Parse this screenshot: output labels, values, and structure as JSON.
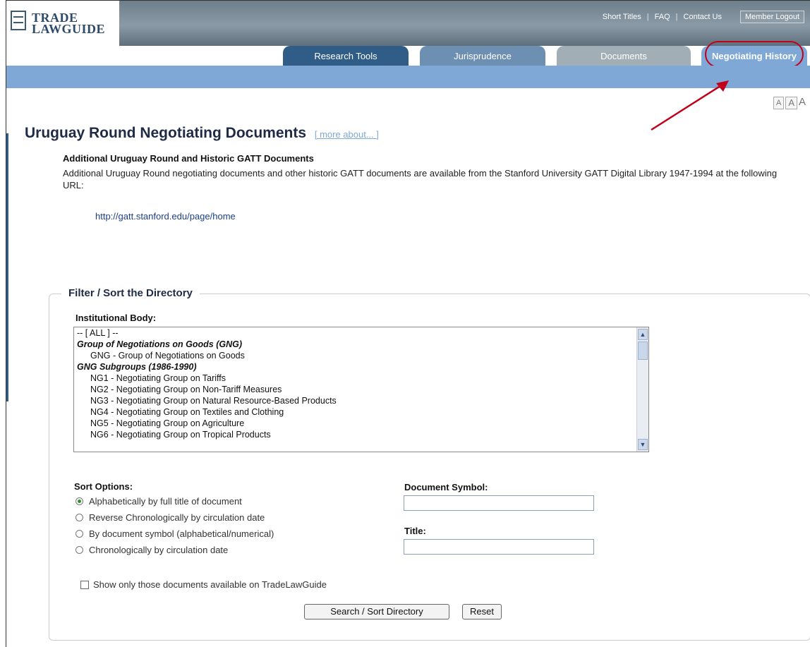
{
  "header": {
    "logo_line1": "TRADE",
    "logo_line2": "LAWGUIDE",
    "links": [
      "Short Titles",
      "FAQ",
      "Contact Us"
    ],
    "logout_label": "Member Logout"
  },
  "tabs": [
    {
      "label": "Research Tools"
    },
    {
      "label": "Jurisprudence"
    },
    {
      "label": "Documents"
    },
    {
      "label": "Negotiating History"
    }
  ],
  "text_size": [
    "A",
    "A",
    "A"
  ],
  "page": {
    "title": "Uruguay Round Negotiating Documents",
    "more_link": "[ more about... ]",
    "additional_heading": "Additional Uruguay Round and Historic GATT Documents",
    "additional_body": "Additional Uruguay Round negotiating documents and other historic GATT documents are available from the Stanford University GATT Digital Library 1947-1994 at the following URL:",
    "url": "http://gatt.stanford.edu/page/home"
  },
  "filter": {
    "legend": "Filter / Sort the Directory",
    "institutional_label": "Institutional Body:",
    "list_items": [
      {
        "text": "-- [ ALL ] --",
        "type": "all"
      },
      {
        "text": "Group of Negotiations on Goods (GNG)",
        "type": "group"
      },
      {
        "text": "GNG - Group of Negotiations on Goods",
        "type": "indent"
      },
      {
        "text": "GNG Subgroups (1986-1990)",
        "type": "group"
      },
      {
        "text": "NG1 - Negotiating Group on Tariffs",
        "type": "indent"
      },
      {
        "text": "NG2 - Negotiating Group on Non-Tariff Measures",
        "type": "indent"
      },
      {
        "text": "NG3 - Negotiating Group on Natural Resource-Based Products",
        "type": "indent"
      },
      {
        "text": "NG4 - Negotiating Group on Textiles and Clothing",
        "type": "indent"
      },
      {
        "text": "NG5 - Negotiating Group on Agriculture",
        "type": "indent"
      },
      {
        "text": "NG6 - Negotiating Group on Tropical Products",
        "type": "indent"
      }
    ],
    "sort_label": "Sort Options:",
    "sort_options": [
      {
        "label": "Alphabetically by full title of document",
        "selected": true
      },
      {
        "label": "Reverse Chronologically by circulation date",
        "selected": false
      },
      {
        "label": "By document symbol (alphabetical/numerical)",
        "selected": false
      },
      {
        "label": "Chronologically by circulation date",
        "selected": false
      }
    ],
    "doc_symbol_label": "Document Symbol:",
    "doc_symbol_value": "",
    "title_label": "Title:",
    "title_value": "",
    "checkbox_label": "Show only those documents available on TradeLawGuide",
    "search_button": "Search / Sort Directory",
    "reset_button": "Reset"
  }
}
